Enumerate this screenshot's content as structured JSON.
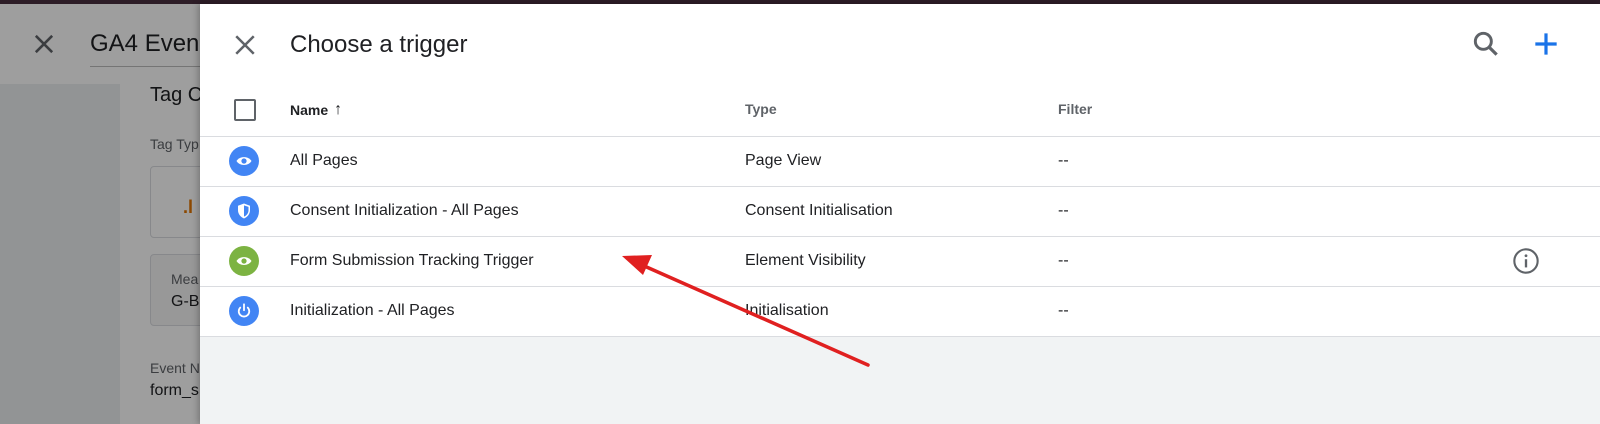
{
  "background": {
    "title": "GA4 Even",
    "card_title": "Tag C",
    "tag_type_label": "Tag Typ",
    "measurement_label": "Mea",
    "measurement_value": "G-B",
    "event_name_label": "Event N",
    "event_name_value": "form_s"
  },
  "panel": {
    "title": "Choose a trigger",
    "columns": {
      "name": "Name",
      "type": "Type",
      "filter": "Filter"
    },
    "sort_indicator": "↑",
    "rows": [
      {
        "name": "All Pages",
        "type": "Page View",
        "filter": "--",
        "icon": "eye-icon",
        "icon_color": "#4285f4"
      },
      {
        "name": "Consent Initialization - All Pages",
        "type": "Consent Initialisation",
        "filter": "--",
        "icon": "shield-icon",
        "icon_color": "#4285f4"
      },
      {
        "name": "Form Submission Tracking Trigger",
        "type": "Element Visibility",
        "filter": "--",
        "icon": "eye-icon",
        "icon_color": "#7cb342"
      },
      {
        "name": "Initialization - All Pages",
        "type": "Initialisation",
        "filter": "--",
        "icon": "power-icon",
        "icon_color": "#4285f4"
      }
    ]
  },
  "colors": {
    "accent": "#1a73e8",
    "annotation_arrow": "#e02020",
    "row_border": "#dadce0"
  }
}
